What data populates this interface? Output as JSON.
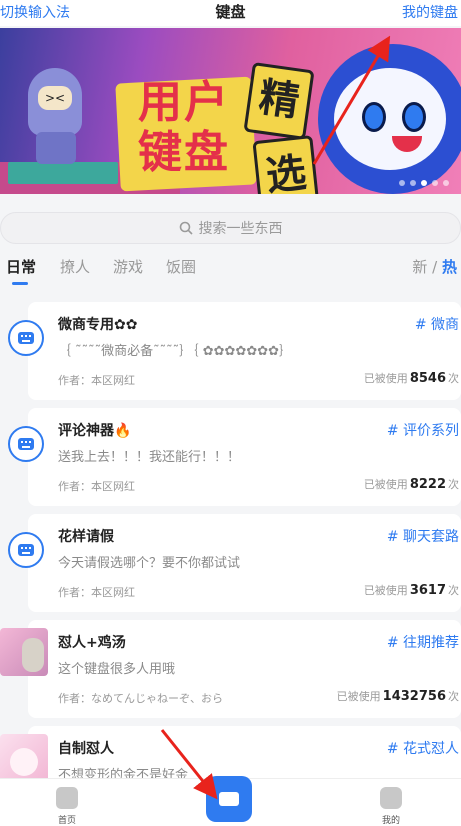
{
  "topbar": {
    "switch_label": "切换输入法",
    "title": "键盘",
    "my_keyboard_label": "我的键盘"
  },
  "banner": {
    "title_text": "用户键盘",
    "sticker_chars": [
      "精",
      "选"
    ],
    "alien_face": "><"
  },
  "search": {
    "placeholder": "搜索一些东西"
  },
  "tabs": [
    {
      "label": "日常",
      "active": true
    },
    {
      "label": "撩人",
      "active": false
    },
    {
      "label": "游戏",
      "active": false
    },
    {
      "label": "饭圈",
      "active": false
    }
  ],
  "sort": {
    "new_label": "新",
    "separator": "/",
    "hot_label": "热"
  },
  "cards": [
    {
      "name": "微商专用✿✿",
      "tag": "# 微商",
      "desc": "｛ ˜˜˜˜微商必备˜˜˜˜｝｛ ✿✿✿✿✿✿✿｝",
      "author": "作者：本区网红",
      "used_prefix": "已被使用",
      "used_count": "8546",
      "used_suffix": "次",
      "icon": "keyboard-icon"
    },
    {
      "name": "评论神器🔥",
      "tag": "# 评价系列",
      "desc": "送我上去！！！我还能行！！！",
      "author": "作者：本区网红",
      "used_prefix": "已被使用",
      "used_count": "8222",
      "used_suffix": "次",
      "icon": "keyboard-icon"
    },
    {
      "name": "花样请假",
      "tag": "# 聊天套路",
      "desc": "今天请假选哪个？要不你都试试",
      "author": "作者：本区网红",
      "used_prefix": "已被使用",
      "used_count": "3617",
      "used_suffix": "次",
      "icon": "keyboard-icon"
    },
    {
      "name": "怼人+鸡汤",
      "tag": "# 往期推荐",
      "desc": "这个键盘很多人用哦",
      "author": "作者：なめてんじゃねーぞ、おら",
      "used_prefix": "已被使用",
      "used_count": "1432756",
      "used_suffix": "次",
      "icon": "avatar-image"
    },
    {
      "name": "自制怼人",
      "tag": "# 花式怼人",
      "desc": "不想变形的金不是好金",
      "author": "",
      "used_prefix": "",
      "used_count": "",
      "used_suffix": "",
      "icon": "avatar-image"
    }
  ],
  "bottom_nav": {
    "home_label": "首页",
    "mine_label": "我的"
  },
  "colors": {
    "accent": "#2f7bf0",
    "annotation": "#e8231c"
  }
}
